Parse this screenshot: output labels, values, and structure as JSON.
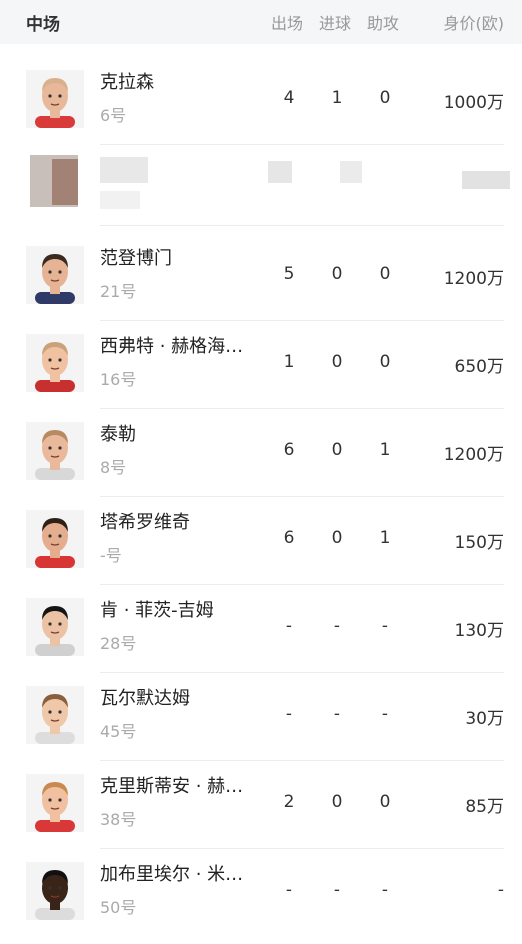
{
  "header": {
    "title": "中场",
    "col_apps": "出场",
    "col_goals": "进球",
    "col_assists": "助攻",
    "col_value": "身价(欧)"
  },
  "players": [
    {
      "name": "克拉森",
      "number": "6号",
      "apps": "4",
      "goals": "1",
      "assists": "0",
      "value": "1000万",
      "skin": "#e8b89a",
      "hair": "#d9b08c",
      "shirt": "#d93a3a"
    },
    {
      "name": "范登博门",
      "number": "21号",
      "apps": "5",
      "goals": "0",
      "assists": "0",
      "value": "1200万",
      "skin": "#e6b494",
      "hair": "#3a2a20",
      "shirt": "#2f3a66"
    },
    {
      "name": "西弗特 · 赫格海…",
      "number": "16号",
      "apps": "1",
      "goals": "0",
      "assists": "0",
      "value": "650万",
      "skin": "#f0c2a2",
      "hair": "#c9a27a",
      "shirt": "#c83030"
    },
    {
      "name": "泰勒",
      "number": "8号",
      "apps": "6",
      "goals": "0",
      "assists": "1",
      "value": "1200万",
      "skin": "#eab99c",
      "hair": "#b88a62",
      "shirt": "#d8d8d8"
    },
    {
      "name": "塔希罗维奇",
      "number": "-号",
      "apps": "6",
      "goals": "0",
      "assists": "1",
      "value": "150万",
      "skin": "#e4ae8e",
      "hair": "#2e1f17",
      "shirt": "#d83535"
    },
    {
      "name": "肯 · 菲茨-吉姆",
      "number": "28号",
      "apps": "-",
      "goals": "-",
      "assists": "-",
      "value": "130万",
      "skin": "#ecc2a4",
      "hair": "#151515",
      "shirt": "#d0d0d0"
    },
    {
      "name": "瓦尔默达姆",
      "number": "45号",
      "apps": "-",
      "goals": "-",
      "assists": "-",
      "value": "30万",
      "skin": "#efc7a9",
      "hair": "#8a5f3c",
      "shirt": "#dddddd"
    },
    {
      "name": "克里斯蒂安 · 赫…",
      "number": "38号",
      "apps": "2",
      "goals": "0",
      "assists": "0",
      "value": "85万",
      "skin": "#f0c0a0",
      "hair": "#c88a4e",
      "shirt": "#d83838"
    },
    {
      "name": "加布里埃尔 · 米…",
      "number": "50号",
      "apps": "-",
      "goals": "-",
      "assists": "-",
      "value": "-",
      "skin": "#3a2418",
      "hair": "#111111",
      "shirt": "#dcdcdc"
    }
  ]
}
